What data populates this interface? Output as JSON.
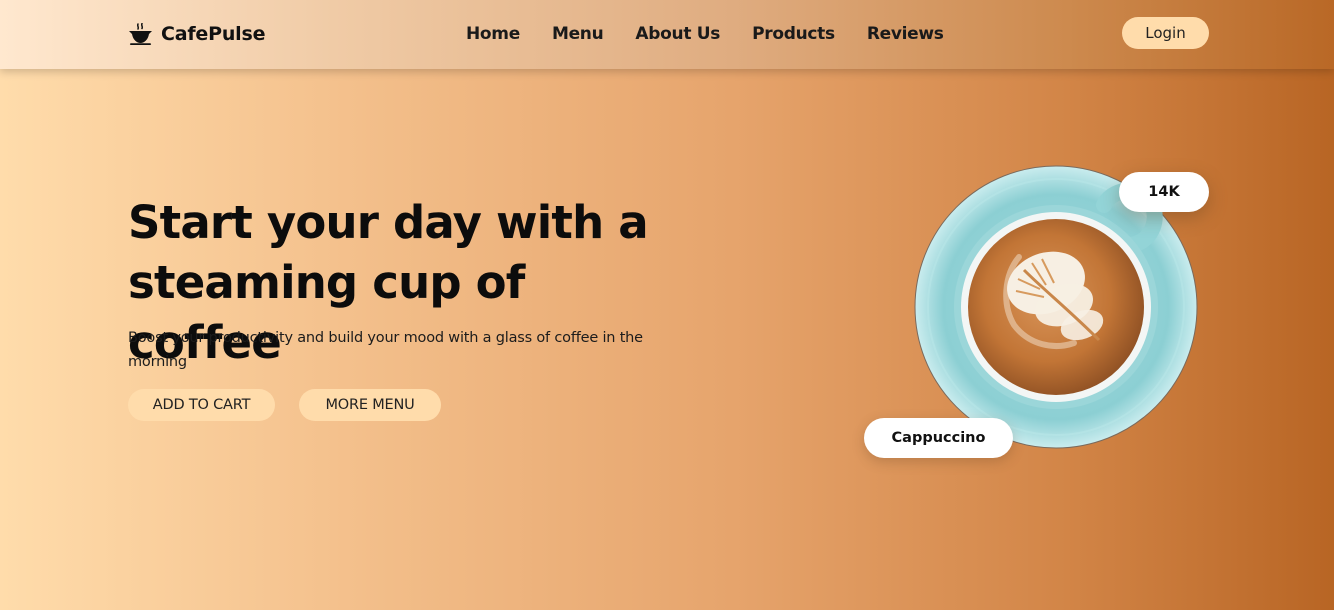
{
  "brand": {
    "name": "CafePulse",
    "icon": "coffee-cup-icon"
  },
  "nav": {
    "links": [
      "Home",
      "Menu",
      "About Us",
      "Products",
      "Reviews"
    ],
    "login_label": "Login"
  },
  "hero": {
    "title": "Start your day with a steaming cup of coffee",
    "subtitle": "Boost your productivity and build your mood with a glass of coffee in the morning",
    "add_to_cart_label": "ADD TO CART",
    "more_menu_label": "MORE MENU"
  },
  "product_card": {
    "image": "cappuccino-cup-image",
    "count_badge": "14K",
    "name_badge": "Cappuccino"
  },
  "colors": {
    "gradient_start": "#ffdcab",
    "gradient_end": "#b86524",
    "button_bg": "#ffdcab",
    "badge_bg": "#ffffff",
    "saucer": "#8fd3d6"
  }
}
